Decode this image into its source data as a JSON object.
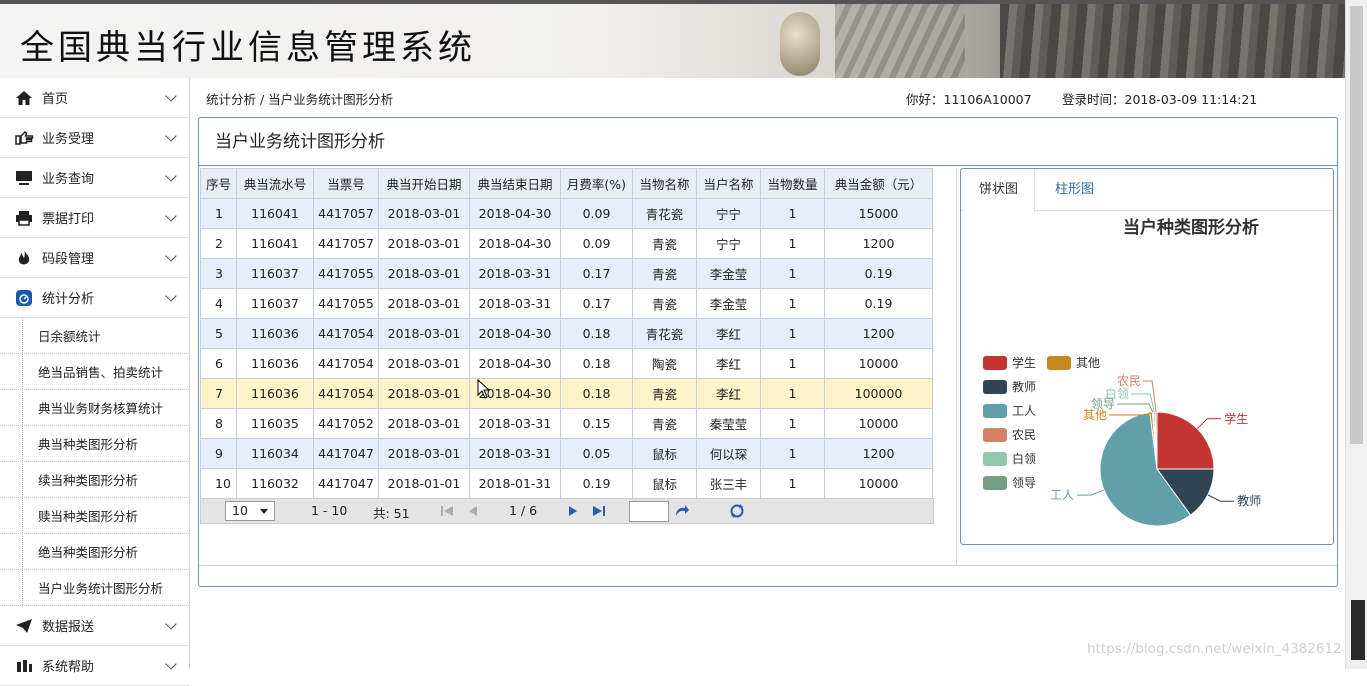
{
  "app": {
    "title": "全国典当行业信息管理系统"
  },
  "sidebar": {
    "items": [
      {
        "label": "首页",
        "icon": "home-icon"
      },
      {
        "label": "业务受理",
        "icon": "pointing-hand-icon"
      },
      {
        "label": "业务查询",
        "icon": "monitor-icon"
      },
      {
        "label": "票据打印",
        "icon": "printer-icon"
      },
      {
        "label": "码段管理",
        "icon": "flame-icon"
      },
      {
        "label": "统计分析",
        "icon": "scale-icon"
      }
    ],
    "subitems": [
      "日余额统计",
      "绝当品销售、拍卖统计",
      "典当业务财务核算统计",
      "典当种类图形分析",
      "续当种类图形分析",
      "赎当种类图形分析",
      "绝当种类图形分析",
      "当户业务统计图形分析"
    ],
    "bottom_items": [
      {
        "label": "数据报送",
        "icon": "send-icon"
      },
      {
        "label": "系统帮助",
        "icon": "help-icon"
      }
    ]
  },
  "header": {
    "breadcrumb": "统计分析 / 当户业务统计图形分析",
    "greeting": "你好：11106A10007",
    "login_time": "登录时间：2018-03-09 11:14:21"
  },
  "panel": {
    "title": "当户业务统计图形分析"
  },
  "grid": {
    "columns": [
      "序号",
      "典当流水号",
      "当票号",
      "典当开始日期",
      "典当结束日期",
      "月费率(%)",
      "当物名称",
      "当户名称",
      "当物数量",
      "典当金额（元）"
    ],
    "rows": [
      [
        "1",
        "116041",
        "4417057",
        "2018-03-01",
        "2018-04-30",
        "0.09",
        "青花瓷",
        "宁宁",
        "1",
        "15000"
      ],
      [
        "2",
        "116041",
        "4417057",
        "2018-03-01",
        "2018-04-30",
        "0.09",
        "青瓷",
        "宁宁",
        "1",
        "1200"
      ],
      [
        "3",
        "116037",
        "4417055",
        "2018-03-01",
        "2018-03-31",
        "0.17",
        "青瓷",
        "李金莹",
        "1",
        "0.19"
      ],
      [
        "4",
        "116037",
        "4417055",
        "2018-03-01",
        "2018-03-31",
        "0.17",
        "青瓷",
        "李金莹",
        "1",
        "0.19"
      ],
      [
        "5",
        "116036",
        "4417054",
        "2018-03-01",
        "2018-04-30",
        "0.18",
        "青花瓷",
        "李红",
        "1",
        "1200"
      ],
      [
        "6",
        "116036",
        "4417054",
        "2018-03-01",
        "2018-04-30",
        "0.18",
        "陶瓷",
        "李红",
        "1",
        "10000"
      ],
      [
        "7",
        "116036",
        "4417054",
        "2018-03-01",
        "2018-04-30",
        "0.18",
        "青瓷",
        "李红",
        "1",
        "100000"
      ],
      [
        "8",
        "116035",
        "4417052",
        "2018-03-01",
        "2018-03-31",
        "0.15",
        "青瓷",
        "秦莹莹",
        "1",
        "10000"
      ],
      [
        "9",
        "116034",
        "4417047",
        "2018-03-01",
        "2018-03-31",
        "0.05",
        "鼠标",
        "何以琛",
        "1",
        "1200"
      ],
      [
        "10",
        "116032",
        "4417047",
        "2018-01-01",
        "2018-01-31",
        "0.19",
        "鼠标",
        "张三丰",
        "1",
        "10000"
      ]
    ],
    "highlight_row": 6
  },
  "pager": {
    "page_size": "10",
    "range": "1 - 10",
    "total": "共: 51",
    "page": "1 / 6",
    "jump_value": ""
  },
  "chart_tabs": [
    "饼状图",
    "柱形图"
  ],
  "chart_data": {
    "type": "pie",
    "title": "当户种类图形分析",
    "legend": [
      {
        "name": "学生",
        "color": "#c23531"
      },
      {
        "name": "其他",
        "color": "#ca8622"
      },
      {
        "name": "教师",
        "color": "#2f4554"
      },
      {
        "name": "工人",
        "color": "#61a0a8"
      },
      {
        "name": "农民",
        "color": "#d48265"
      },
      {
        "name": "白领",
        "color": "#91c7ae"
      },
      {
        "name": "领导",
        "color": "#749f83"
      }
    ],
    "slices": [
      {
        "name": "学生",
        "value": 25,
        "color": "#c23531"
      },
      {
        "name": "教师",
        "value": 15,
        "color": "#2f4554"
      },
      {
        "name": "工人",
        "value": 58,
        "color": "#61a0a8"
      },
      {
        "name": "其他",
        "value": 0.7,
        "color": "#ca8622"
      },
      {
        "name": "领导",
        "value": 0.3,
        "color": "#749f83"
      },
      {
        "name": "白领",
        "value": 0.5,
        "color": "#91c7ae"
      },
      {
        "name": "农民",
        "value": 0.5,
        "color": "#d48265"
      }
    ],
    "legend_position": "left"
  },
  "watermark": "https://blog.csdn.net/weixin_4382612"
}
